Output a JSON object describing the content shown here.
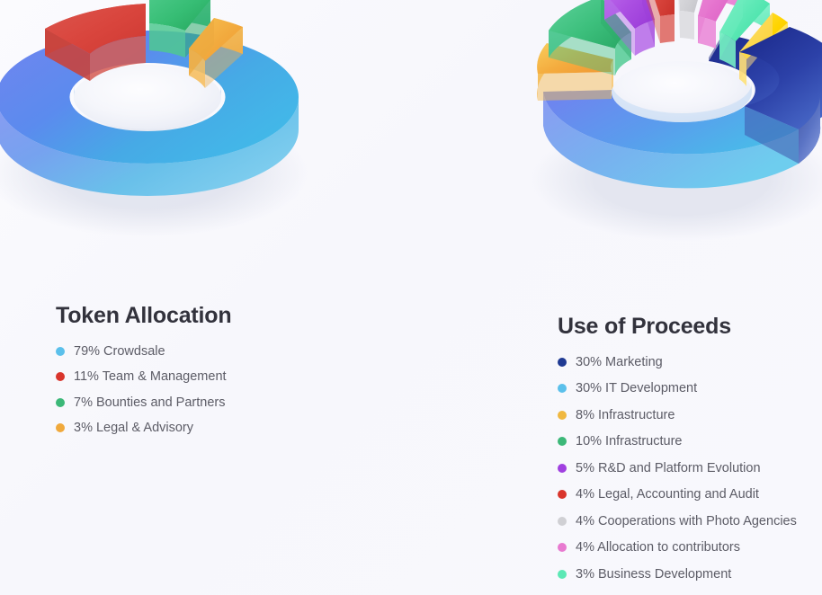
{
  "page": {
    "background_color": "#f9f9fd",
    "heading_color": "#32323c",
    "label_color": "#5c5c66"
  },
  "charts": [
    {
      "id": "token-allocation",
      "title": "Token Allocation",
      "chart_type": "donut-3d",
      "legend_position": "below-left",
      "items": [
        {
          "label": "79% Crowdsale",
          "value": 79,
          "color": "#5bc0eb",
          "ring_from": "#5b77ea",
          "ring_to": "#3cb3e8",
          "elevation": 0
        },
        {
          "label": "11% Team & Management",
          "value": 11,
          "color": "#d9352c",
          "ring_from": "#d9473f",
          "ring_to": "#cf3f38",
          "elevation": 30
        },
        {
          "label": "7% Bounties and Partners",
          "value": 7,
          "color": "#3cb878",
          "ring_from": "#2cb96a",
          "ring_to": "#4cc98a",
          "elevation": 44
        },
        {
          "label": "3% Legal & Advisory",
          "value": 3,
          "color": "#f0a93c",
          "ring_from": "#f2ad3e",
          "ring_to": "#f6c24e",
          "elevation": 26
        }
      ]
    },
    {
      "id": "use-of-proceeds",
      "title": "Use of Proceeds",
      "chart_type": "donut-3d",
      "legend_position": "below-right",
      "items": [
        {
          "label": "30% Marketing",
          "value": 30,
          "color": "#1f3a93",
          "ring_from": "#1e2f8e",
          "ring_to": "#4a6fd0",
          "elevation": 0
        },
        {
          "label": "30% IT Development",
          "value": 30,
          "color": "#5bc0eb",
          "ring_from": "#5b77ea",
          "ring_to": "#4fc3e8",
          "elevation": 0
        },
        {
          "label": "8% Infrastructure",
          "value": 8,
          "color": "#f0b840",
          "ring_from": "#f5b03e",
          "ring_to": "#f8cf52",
          "elevation": 34
        },
        {
          "label": "10% Infrastructure",
          "value": 10,
          "color": "#3cb878",
          "ring_from": "#35b97a",
          "ring_to": "#57cf96",
          "elevation": 46
        },
        {
          "label": "5% R&D and Platform Evolution",
          "value": 5,
          "color": "#a040e0",
          "ring_from": "#a84fe0",
          "ring_to": "#bb63ea",
          "elevation": 48
        },
        {
          "label": "4% Legal, Accounting and Audit",
          "value": 4,
          "color": "#d9352c",
          "ring_from": "#d8443c",
          "ring_to": "#e0564c",
          "elevation": 52
        },
        {
          "label": "4% Cooperations with Photo Agencies",
          "value": 4,
          "color": "#d0d0d4",
          "ring_from": "#c9c9cd",
          "ring_to": "#dcdce0",
          "elevation": 56
        },
        {
          "label": "4% Allocation to contributors",
          "value": 4,
          "color": "#e87ad0",
          "ring_from": "#e471c9",
          "ring_to": "#f08ad8",
          "elevation": 52
        },
        {
          "label": "3% Business Development",
          "value": 3,
          "color": "#5ce8b5",
          "ring_from": "#55e3ad",
          "ring_to": "#77f0c4",
          "elevation": 44
        }
      ],
      "extra_slices": [
        {
          "label": "yellow-sliver",
          "value": 2,
          "color": "#ffd500",
          "ring_from": "#ffd400",
          "ring_to": "#ffe23a",
          "elevation": 36
        }
      ]
    }
  ]
}
